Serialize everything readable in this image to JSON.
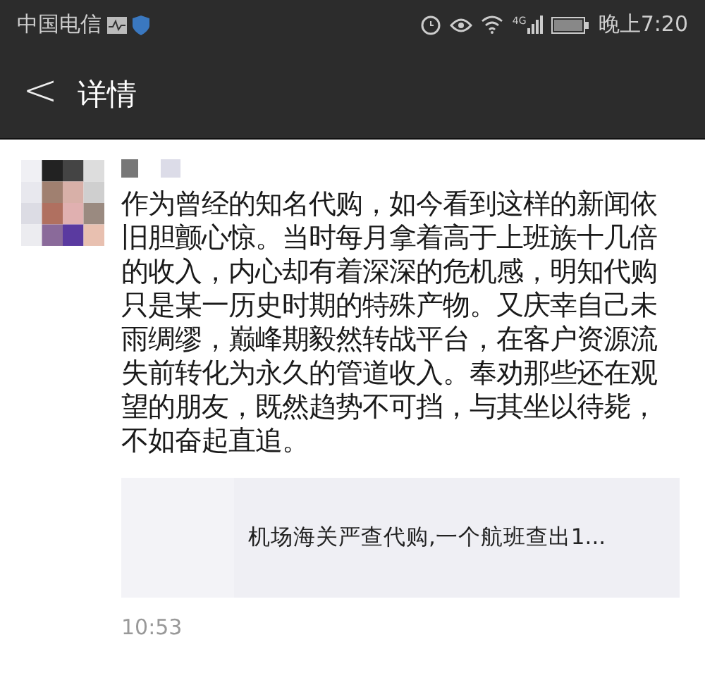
{
  "status_bar": {
    "carrier": "中国电信",
    "network": "4G",
    "time": "晚上7:20"
  },
  "nav": {
    "back": "<",
    "title": "详情"
  },
  "post": {
    "text": "作为曾经的知名代购，如今看到这样的新闻依旧胆颤心惊。当时每月拿着高于上班族十几倍的收入，内心却有着深深的危机感，明知代购只是某一历史时期的特殊产物。又庆幸自己未雨绸缪，巅峰期毅然转战平台，在客户资源流失前转化为永久的管道收入。奉劝那些还在观望的朋友，既然趋势不可挡，与其坐以待毙，不如奋起直追。",
    "link": {
      "title": "机场海关严查代购,一个航班查出1..."
    },
    "time": "10:53"
  }
}
